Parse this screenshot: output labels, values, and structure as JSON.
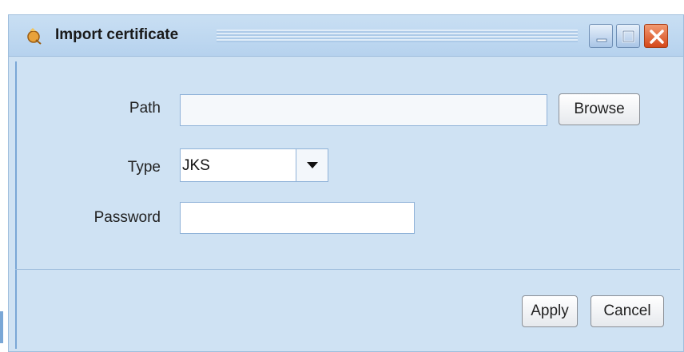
{
  "window": {
    "title": "Import certificate",
    "icon": "certificate-app-icon",
    "controls": {
      "minimize_icon": "minimize-icon",
      "maximize_icon": "maximize-icon",
      "close_icon": "close-icon"
    }
  },
  "form": {
    "path": {
      "label": "Path",
      "value": "",
      "browse_label": "Browse"
    },
    "type": {
      "label": "Type",
      "selected": "JKS"
    },
    "password": {
      "label": "Password",
      "value": ""
    }
  },
  "actions": {
    "apply_label": "Apply",
    "cancel_label": "Cancel"
  },
  "colors": {
    "window_bg": "#cfe2f3",
    "close_button": "#d4481a"
  }
}
